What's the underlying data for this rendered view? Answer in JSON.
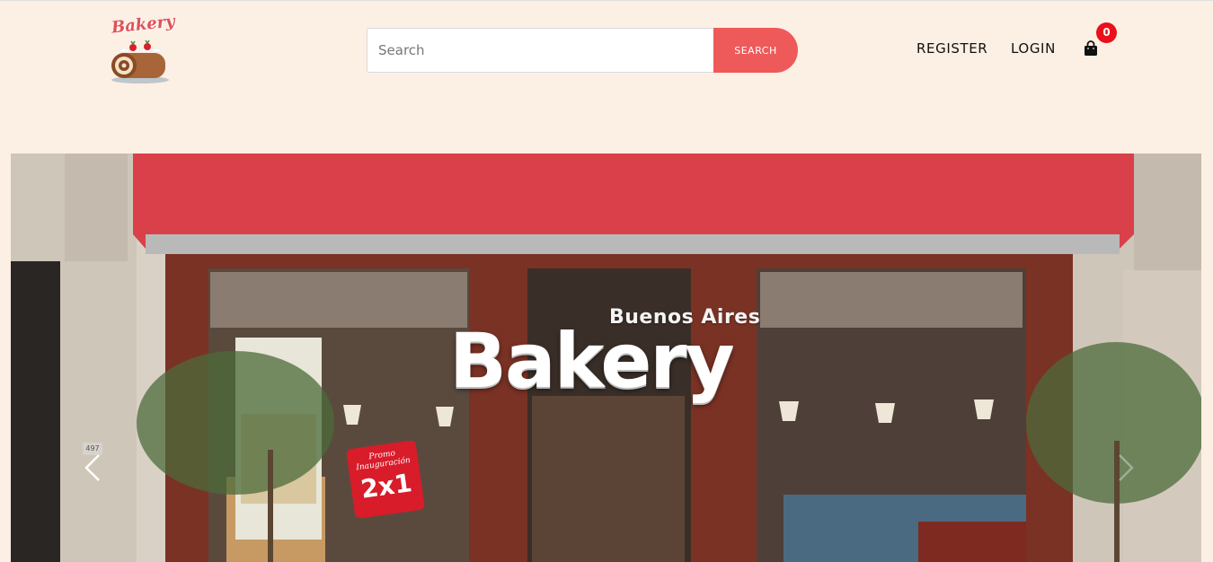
{
  "header": {
    "logo_text": "Bakery",
    "search": {
      "placeholder": "Search",
      "value": "",
      "button_label": "SEARCH"
    },
    "nav": {
      "register_label": "REGISTER",
      "login_label": "LOGIN"
    },
    "cart": {
      "icon": "shopping-bag-icon",
      "count": "0"
    }
  },
  "hero": {
    "sign_small": "Buenos Aires",
    "sign_big": "Bakery",
    "promo_top": "Promo Inauguración",
    "promo_main": "2x1",
    "store_number": "497",
    "prev_icon": "chevron-left-icon",
    "next_icon": "chevron-right-icon"
  },
  "colors": {
    "background": "#fcefe4",
    "accent": "#ee5a5a",
    "badge": "#e8101a",
    "awning": "#d9404a",
    "storefront": "#7a3224"
  }
}
